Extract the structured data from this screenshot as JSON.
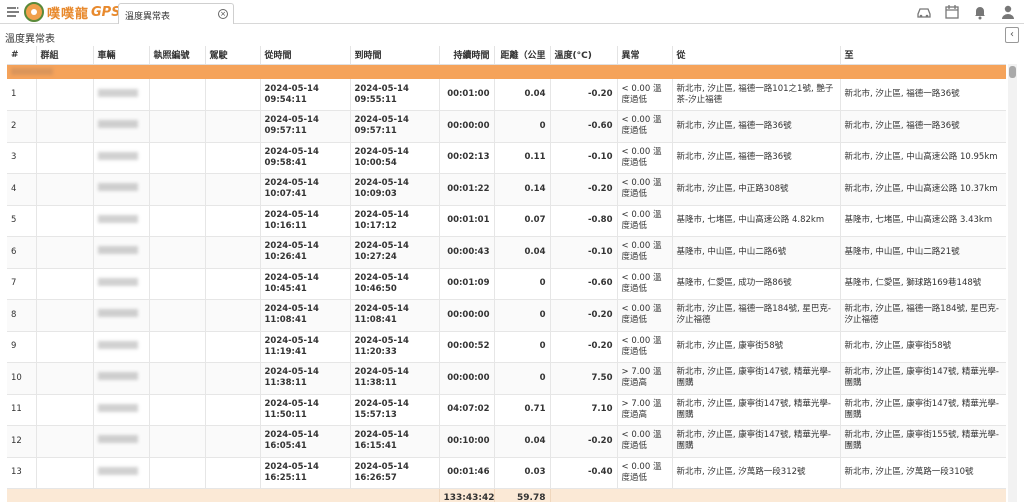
{
  "app": {
    "logo_text": "噗噗龍",
    "logo_gps": "GPS",
    "tab_label": "溫度異常表"
  },
  "page": {
    "title": "溫度異常表"
  },
  "columns": [
    "#",
    "群組",
    "車輛",
    "執照編號",
    "駕駛",
    "從時間",
    "到時間",
    "持續時間",
    "距離（公里",
    "溫度(°C)",
    "異常",
    "從",
    "至"
  ],
  "rows": [
    {
      "n": "1",
      "from_time": "2024-05-14 09:54:11",
      "to_time": "2024-05-14 09:55:11",
      "duration": "00:01:00",
      "distance": "0.04",
      "temp": "-0.20",
      "abnormal": "< 0.00 溫度過低",
      "from": "新北市, 汐止區, 福德一路101之1號, 艷子茶-汐止福德",
      "to": "新北市, 汐止區, 福德一路36號"
    },
    {
      "n": "2",
      "from_time": "2024-05-14 09:57:11",
      "to_time": "2024-05-14 09:57:11",
      "duration": "00:00:00",
      "distance": "0",
      "temp": "-0.60",
      "abnormal": "< 0.00 溫度過低",
      "from": "新北市, 汐止區, 福德一路36號",
      "to": "新北市, 汐止區, 福德一路36號"
    },
    {
      "n": "3",
      "from_time": "2024-05-14 09:58:41",
      "to_time": "2024-05-14 10:00:54",
      "duration": "00:02:13",
      "distance": "0.11",
      "temp": "-0.10",
      "abnormal": "< 0.00 溫度過低",
      "from": "新北市, 汐止區, 福德一路36號",
      "to": "新北市, 汐止區, 中山高速公路 10.95km"
    },
    {
      "n": "4",
      "from_time": "2024-05-14 10:07:41",
      "to_time": "2024-05-14 10:09:03",
      "duration": "00:01:22",
      "distance": "0.14",
      "temp": "-0.20",
      "abnormal": "< 0.00 溫度過低",
      "from": "新北市, 汐止區, 中正路308號",
      "to": "新北市, 汐止區, 中山高速公路 10.37km"
    },
    {
      "n": "5",
      "from_time": "2024-05-14 10:16:11",
      "to_time": "2024-05-14 10:17:12",
      "duration": "00:01:01",
      "distance": "0.07",
      "temp": "-0.80",
      "abnormal": "< 0.00 溫度過低",
      "from": "基隆市, 七堵區, 中山高速公路 4.82km",
      "to": "基隆市, 七堵區, 中山高速公路 3.43km"
    },
    {
      "n": "6",
      "from_time": "2024-05-14 10:26:41",
      "to_time": "2024-05-14 10:27:24",
      "duration": "00:00:43",
      "distance": "0.04",
      "temp": "-0.10",
      "abnormal": "< 0.00 溫度過低",
      "from": "基隆市, 中山區, 中山二路6號",
      "to": "基隆市, 中山區, 中山二路21號"
    },
    {
      "n": "7",
      "from_time": "2024-05-14 10:45:41",
      "to_time": "2024-05-14 10:46:50",
      "duration": "00:01:09",
      "distance": "0",
      "temp": "-0.60",
      "abnormal": "< 0.00 溫度過低",
      "from": "基隆市, 仁愛區, 成功一路86號",
      "to": "基隆市, 仁愛區, 獅球路169巷148號"
    },
    {
      "n": "8",
      "from_time": "2024-05-14 11:08:41",
      "to_time": "2024-05-14 11:08:41",
      "duration": "00:00:00",
      "distance": "0",
      "temp": "-0.20",
      "abnormal": "< 0.00 溫度過低",
      "from": "新北市, 汐止區, 福德一路184號, 星巴克-汐止福德",
      "to": "新北市, 汐止區, 福德一路184號, 星巴克-汐止福德"
    },
    {
      "n": "9",
      "from_time": "2024-05-14 11:19:41",
      "to_time": "2024-05-14 11:20:33",
      "duration": "00:00:52",
      "distance": "0",
      "temp": "-0.20",
      "abnormal": "< 0.00 溫度過低",
      "from": "新北市, 汐止區, 康寧街58號",
      "to": "新北市, 汐止區, 康寧街58號"
    },
    {
      "n": "10",
      "from_time": "2024-05-14 11:38:11",
      "to_time": "2024-05-14 11:38:11",
      "duration": "00:00:00",
      "distance": "0",
      "temp": "7.50",
      "abnormal": "> 7.00 溫度過高",
      "from": "新北市, 汐止區, 康寧街147號, 精華光學-團購",
      "to": "新北市, 汐止區, 康寧街147號, 精華光學-團購"
    },
    {
      "n": "11",
      "from_time": "2024-05-14 11:50:11",
      "to_time": "2024-05-14 15:57:13",
      "duration": "04:07:02",
      "distance": "0.71",
      "temp": "7.10",
      "abnormal": "> 7.00 溫度過高",
      "from": "新北市, 汐止區, 康寧街147號, 精華光學-團購",
      "to": "新北市, 汐止區, 康寧街147號, 精華光學-團購"
    },
    {
      "n": "12",
      "from_time": "2024-05-14 16:05:41",
      "to_time": "2024-05-14 16:15:41",
      "duration": "00:10:00",
      "distance": "0.04",
      "temp": "-0.20",
      "abnormal": "< 0.00 溫度過低",
      "from": "新北市, 汐止區, 康寧街147號, 精華光學-團購",
      "to": "新北市, 汐止區, 康寧街155號, 精華光學-團購"
    },
    {
      "n": "13",
      "from_time": "2024-05-14 16:25:11",
      "to_time": "2024-05-14 16:26:57",
      "duration": "00:01:46",
      "distance": "0.03",
      "temp": "-0.40",
      "abnormal": "< 0.00 溫度過低",
      "from": "新北市, 汐止區, 汐萬路一段312號",
      "to": "新北市, 汐止區, 汐萬路一段310號"
    }
  ],
  "totals": {
    "duration": "133:43:42",
    "distance": "59.78"
  },
  "colors": {
    "group_row": "#f5a35a",
    "footer_row": "#fbe9d6",
    "logo": "#e88a2e"
  },
  "icons": [
    "menu-icon",
    "car-icon",
    "calendar-icon",
    "bell-icon",
    "user-icon",
    "chevron-left-icon",
    "close-icon"
  ]
}
